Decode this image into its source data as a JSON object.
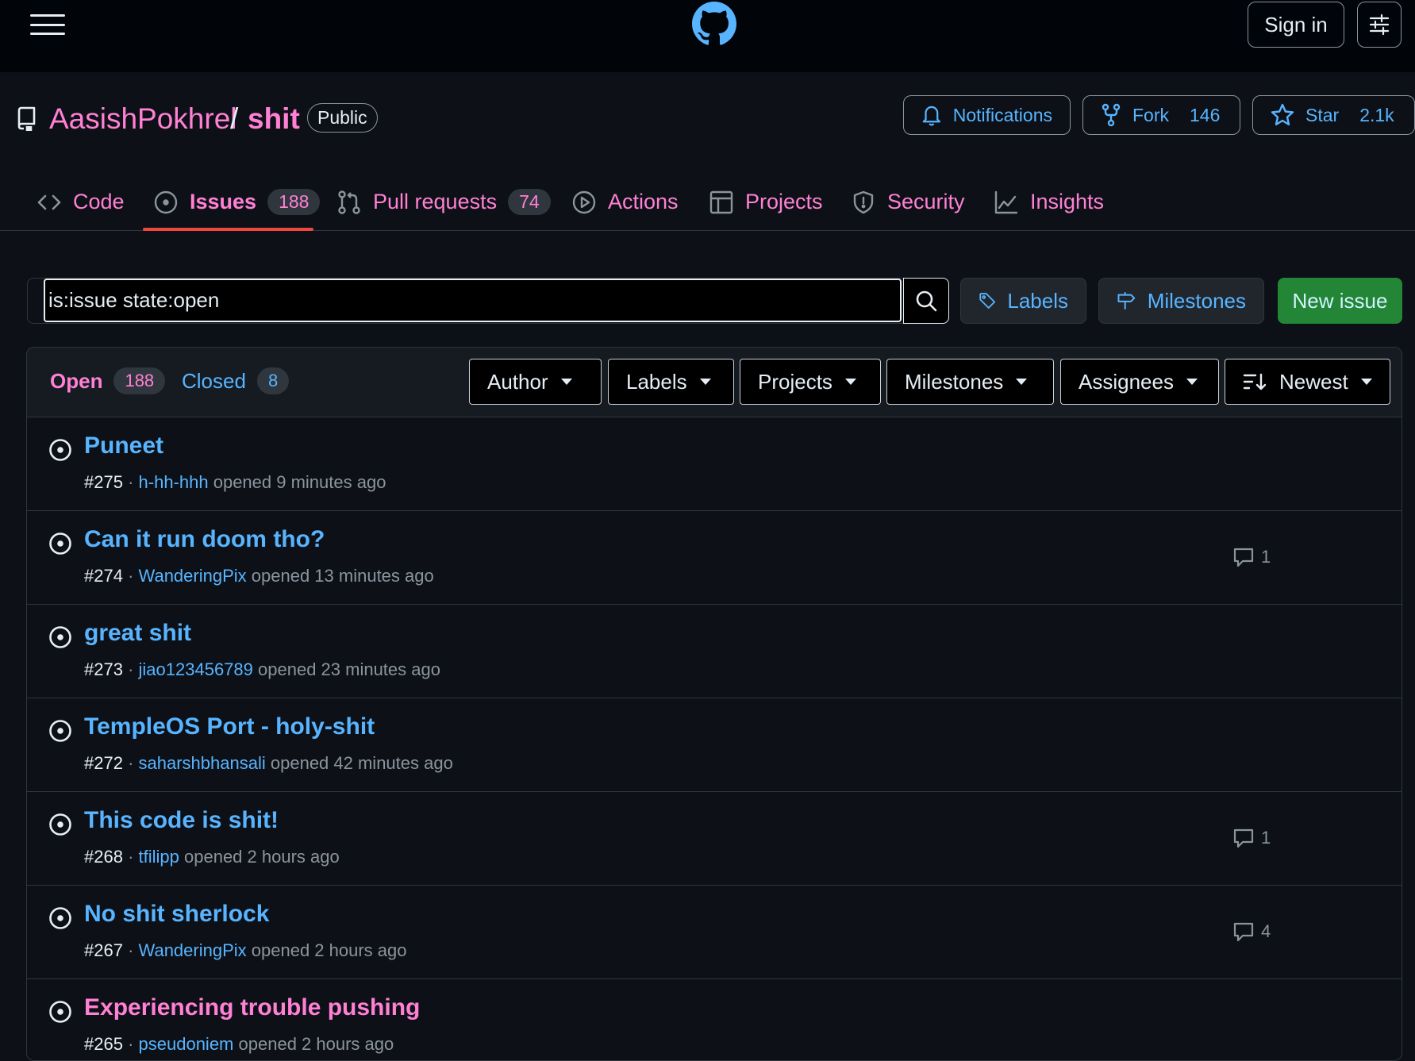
{
  "header": {
    "menu_icon": "hamburger-menu-icon",
    "logo_icon": "github-mark-icon",
    "sign_in_label": "Sign in",
    "settings_icon": "sliders-icon"
  },
  "repo": {
    "icon": "repo-icon",
    "owner": "AasishPokhrel",
    "separator": "/",
    "name": "shit",
    "visibility": "Public",
    "notifications_label": "Notifications",
    "fork_label": "Fork",
    "fork_count": "146",
    "star_label": "Star",
    "star_count": "2.1k"
  },
  "tabs": [
    {
      "label": "Code",
      "icon": "code-icon"
    },
    {
      "label": "Issues",
      "icon": "issue-opened-icon",
      "count": "188",
      "selected": true
    },
    {
      "label": "Pull requests",
      "icon": "git-pull-request-icon",
      "count": "74"
    },
    {
      "label": "Actions",
      "icon": "play-icon"
    },
    {
      "label": "Projects",
      "icon": "table-icon"
    },
    {
      "label": "Security",
      "icon": "shield-icon"
    },
    {
      "label": "Insights",
      "icon": "graph-icon"
    }
  ],
  "search": {
    "value": "is:issue state:open",
    "labels_button": "Labels",
    "milestones_button": "Milestones",
    "new_issue_button": "New issue"
  },
  "states": {
    "open_label": "Open",
    "open_count": "188",
    "closed_label": "Closed",
    "closed_count": "8"
  },
  "filters": [
    "Author",
    "Labels",
    "Projects",
    "Milestones",
    "Assignees",
    "Newest"
  ],
  "issues": [
    {
      "title": "Puneet",
      "number": "#275",
      "author": "h-hh-hhh",
      "opened": "opened 9 minutes ago",
      "comments": ""
    },
    {
      "title": "Can it run doom tho?",
      "number": "#274",
      "author": "WanderingPix",
      "opened": "opened 13 minutes ago",
      "comments": "1"
    },
    {
      "title": "great shit",
      "number": "#273",
      "author": "jiao123456789",
      "opened": "opened 23 minutes ago",
      "comments": ""
    },
    {
      "title": "TempleOS Port - holy-shit",
      "number": "#272",
      "author": "saharshbhansali",
      "opened": "opened 42 minutes ago",
      "comments": ""
    },
    {
      "title": "This code is shit!",
      "number": "#268",
      "author": "tfilipp",
      "opened": "opened 2 hours ago",
      "comments": "1"
    },
    {
      "title": "No shit sherlock",
      "number": "#267",
      "author": "WanderingPix",
      "opened": "opened 2 hours ago",
      "comments": "4"
    },
    {
      "title": "Experiencing trouble pushing",
      "number": "#265",
      "author": "pseudoniem",
      "opened": "opened 2 hours ago",
      "comments": ""
    }
  ],
  "colors": {
    "background": "#0d1117",
    "header_bg": "#010409",
    "link_blue": "#58b4ff",
    "visited_pink": "#ff80d4",
    "selected_underline": "#f0473e",
    "new_issue_green": "#238636"
  }
}
